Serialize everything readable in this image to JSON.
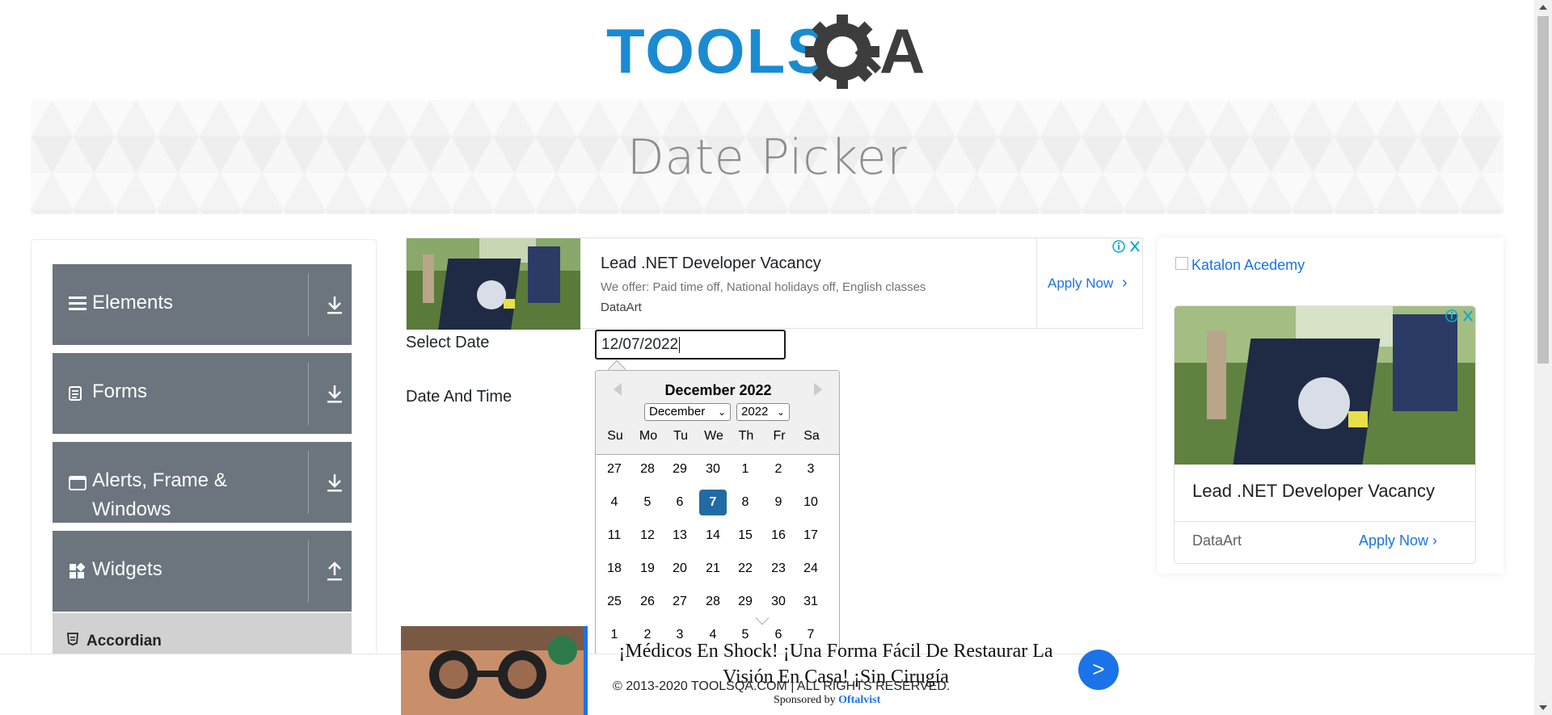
{
  "header": {
    "logo_alt": "TOOLSQA",
    "page_title": "Date Picker"
  },
  "sidebar": {
    "groups": [
      {
        "label": "Elements",
        "icon": "hamburger-icon",
        "arrow": "download-arrow-icon"
      },
      {
        "label": "Forms",
        "icon": "document-icon",
        "arrow": "download-arrow-icon"
      },
      {
        "label": "Alerts, Frame & Windows",
        "icon": "window-icon",
        "arrow": "download-arrow-icon"
      },
      {
        "label": "Widgets",
        "icon": "widgets-icon",
        "arrow": "upload-arrow-icon"
      }
    ],
    "active_item": {
      "label": "Accordian",
      "icon": "html5-icon"
    }
  },
  "ad_top": {
    "title": "Lead .NET Developer Vacancy",
    "description": "We offer: Paid time off, National holidays off, English classes",
    "brand": "DataArt",
    "cta": "Apply Now",
    "cta_chevron": "›"
  },
  "form": {
    "select_date_label": "Select Date",
    "select_date_value": "12/07/2022",
    "date_time_label": "Date And Time"
  },
  "calendar": {
    "title": "December 2022",
    "month_select": "December",
    "year_select": "2022",
    "select_chevron": "⌄",
    "weekdays": [
      "Su",
      "Mo",
      "Tu",
      "We",
      "Th",
      "Fr",
      "Sa"
    ],
    "weeks": [
      [
        "27",
        "28",
        "29",
        "30",
        "1",
        "2",
        "3"
      ],
      [
        "4",
        "5",
        "6",
        "7",
        "8",
        "9",
        "10"
      ],
      [
        "11",
        "12",
        "13",
        "14",
        "15",
        "16",
        "17"
      ],
      [
        "18",
        "19",
        "20",
        "21",
        "22",
        "23",
        "24"
      ],
      [
        "25",
        "26",
        "27",
        "28",
        "29",
        "30",
        "31"
      ],
      [
        "1",
        "2",
        "3",
        "4",
        "5",
        "6",
        "7"
      ]
    ],
    "selected_day": "7"
  },
  "ad_right": {
    "link_text": "Katalon Acedemy",
    "title": "Lead .NET Developer Vacancy",
    "brand": "DataArt",
    "cta": "Apply Now ›"
  },
  "bottom_ad": {
    "text": "¡Médicos En Shock! ¡Una Forma Fácil De Restaurar La Visión En Casa! ¡Sin Cirugía",
    "go_label": ">",
    "sponsored_prefix": "Sponsored by ",
    "sponsor": "Oftalvist"
  },
  "footer": {
    "copyright": "© 2013-2020 TOOLSQA.COM | ALL RIGHTS RESERVED."
  },
  "colors": {
    "brand_blue": "#1b8bd1",
    "sidebar_gray": "#6c757d",
    "calendar_selected": "#216ba5",
    "ad_link_blue": "#1a73e8"
  }
}
